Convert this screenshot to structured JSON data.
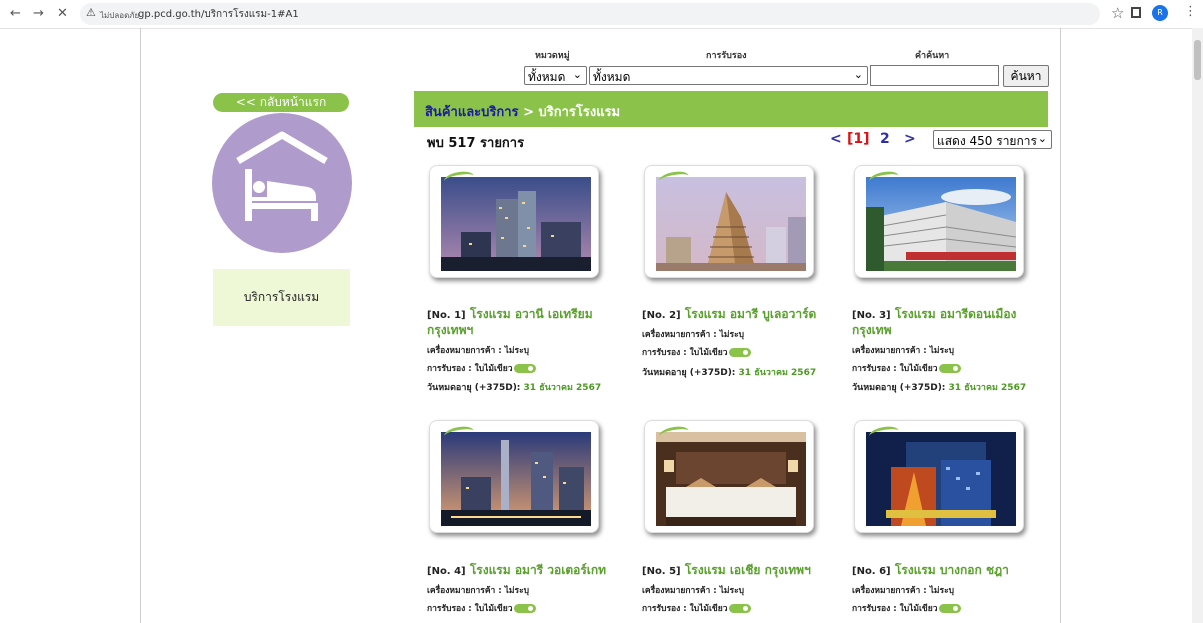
{
  "browser": {
    "security_warning": "ไม่ปลอดภัย",
    "url": "gp.pcd.go.th/บริการโรงแรม-1#A1"
  },
  "filters": {
    "category_label": "หมวดหมู่",
    "category_value": "ทั้งหมด",
    "cert_label": "การรับรอง",
    "cert_value": "ทั้งหมด",
    "search_label": "คำค้นหา",
    "search_placeholder": "",
    "search_button": "ค้นหา"
  },
  "sidebar": {
    "back_label": "<< กลับหน้าแรก",
    "category_name": "บริการโรงแรม"
  },
  "header": {
    "breadcrumb_root": "สินค้าและบริการ",
    "breadcrumb_sep": " > ",
    "breadcrumb_current": "บริการโรงแรม"
  },
  "results": {
    "count_prefix": "พบ",
    "count": "517",
    "count_suffix": "รายการ",
    "pager_prev": "<",
    "pager_current": "[1]",
    "pager_next_page": "2",
    "pager_next": ">",
    "per_page": "แสดง 450 รายการ"
  },
  "labels": {
    "trademark": "เครื่องหมายการค้า : ไม่ระบุ",
    "cert": "การรับรอง : ใบไม้เขียว",
    "expire_label": "วันหมดอายุ (+375D):",
    "expire_date": "31 ธันวาคม 2567"
  },
  "items": [
    {
      "no": "[No. 1]",
      "name": "โรงแรม อวานี เอเทรียม กรุงเทพฯ"
    },
    {
      "no": "[No. 2]",
      "name": "โรงแรม อมารี บูเลอวาร์ด"
    },
    {
      "no": "[No. 3]",
      "name": "โรงแรม อมารีดอนเมือง กรุงเทพ"
    },
    {
      "no": "[No. 4]",
      "name": "โรงแรม อมารี วอเตอร์เกท"
    },
    {
      "no": "[No. 5]",
      "name": "โรงแรม เอเชีย กรุงเทพฯ"
    },
    {
      "no": "[No. 6]",
      "name": "โรงแรม บางกอก ชฎา"
    }
  ]
}
